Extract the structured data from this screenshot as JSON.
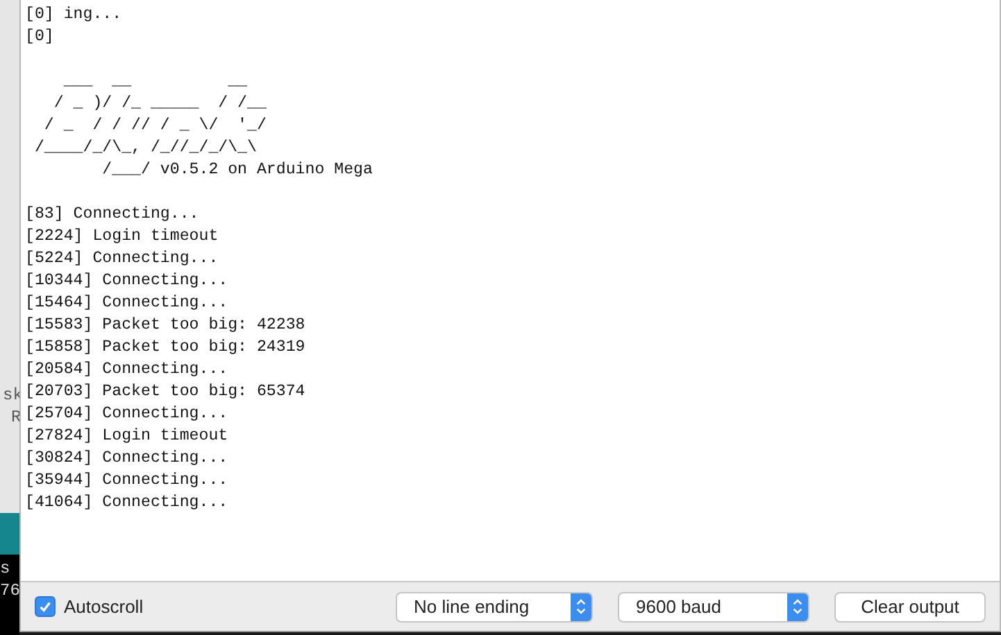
{
  "background_window": {
    "fragments": [
      {
        "text": "sk",
        "kind": "editor"
      },
      {
        "text": "R",
        "kind": "editor"
      },
      {
        "text": "s",
        "kind": "console"
      },
      {
        "text": "76",
        "kind": "console"
      }
    ]
  },
  "output_blocks": [
    [
      "[0] ing...",
      "[0]"
    ],
    [
      "    ___  __          __",
      "   / _ )/ /_ _____  / /__",
      "  / _  / / // / _ \\/  '_/",
      " /____/_/\\_, /_//_/_/\\_\\",
      "        /___/ v0.5.2 on Arduino Mega"
    ],
    [
      "[83] Connecting...",
      "[2224] Login timeout",
      "[5224] Connecting...",
      "[10344] Connecting...",
      "[15464] Connecting...",
      "[15583] Packet too big: 42238",
      "[15858] Packet too big: 24319",
      "[20584] Connecting...",
      "[20703] Packet too big: 65374",
      "[25704] Connecting...",
      "[27824] Login timeout",
      "[30824] Connecting...",
      "[35944] Connecting...",
      "[41064] Connecting..."
    ]
  ],
  "autoscroll": {
    "label": "Autoscroll",
    "checked": true
  },
  "line_ending": {
    "value": "No line ending"
  },
  "baud": {
    "value": "9600 baud"
  },
  "buttons": [
    "Clear output"
  ]
}
